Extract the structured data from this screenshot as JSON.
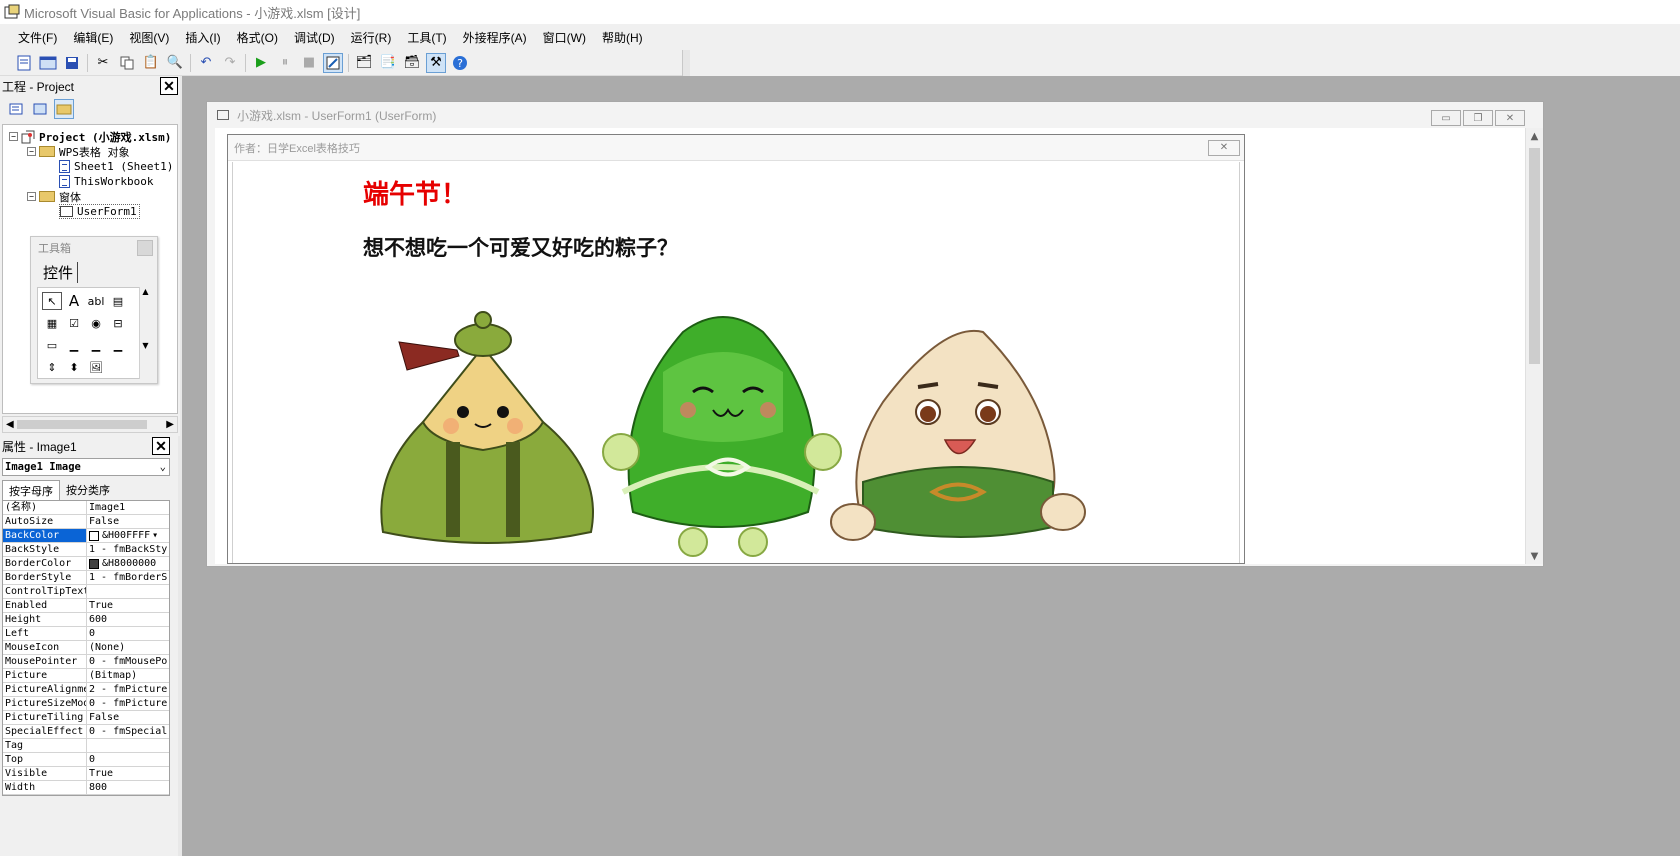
{
  "window": {
    "title": "Microsoft Visual Basic for Applications - 小游戏.xlsm [设计]"
  },
  "menu": [
    "文件(F)",
    "编辑(E)",
    "视图(V)",
    "插入(I)",
    "格式(O)",
    "调试(D)",
    "运行(R)",
    "工具(T)",
    "外接程序(A)",
    "窗口(W)",
    "帮助(H)"
  ],
  "project": {
    "title": "工程 - Project",
    "root": "Project (小游戏.xlsm)",
    "folder_objects": "WPS表格 对象",
    "sheet1": "Sheet1 (Sheet1)",
    "workbook": "ThisWorkbook",
    "folder_forms": "窗体",
    "form": "UserForm1"
  },
  "toolbox": {
    "title": "工具箱",
    "tab": "控件",
    "items": [
      "arrow-icon",
      "label-A",
      "abl",
      "combobox",
      "listbox",
      "checkbox",
      "option",
      "toggle",
      "frame",
      "command",
      "tabstrip",
      "multipage",
      "scrollbar",
      "spin",
      "image"
    ]
  },
  "properties": {
    "title": "属性 - Image1",
    "object": "Image1 Image",
    "tab_alpha": "按字母序",
    "tab_cat": "按分类序",
    "rows": [
      {
        "name": "(名称)",
        "value": "Image1"
      },
      {
        "name": "AutoSize",
        "value": "False"
      },
      {
        "name": "BackColor",
        "value": "&H00FFFF",
        "swatch": "#ffffff",
        "selected": true
      },
      {
        "name": "BackStyle",
        "value": "1 - fmBackSty"
      },
      {
        "name": "BorderColor",
        "value": "&H8000000",
        "swatch": "#404040"
      },
      {
        "name": "BorderStyle",
        "value": "1 - fmBorderS"
      },
      {
        "name": "ControlTipText",
        "value": ""
      },
      {
        "name": "Enabled",
        "value": "True"
      },
      {
        "name": "Height",
        "value": "600"
      },
      {
        "name": "Left",
        "value": "0"
      },
      {
        "name": "MouseIcon",
        "value": "(None)"
      },
      {
        "name": "MousePointer",
        "value": "0 - fmMousePo"
      },
      {
        "name": "Picture",
        "value": "(Bitmap)"
      },
      {
        "name": "PictureAlignme",
        "value": "2 - fmPicture"
      },
      {
        "name": "PictureSizeMod",
        "value": "0 - fmPicture"
      },
      {
        "name": "PictureTiling",
        "value": "False"
      },
      {
        "name": "SpecialEffect",
        "value": "0 - fmSpecial"
      },
      {
        "name": "Tag",
        "value": ""
      },
      {
        "name": "Top",
        "value": "0"
      },
      {
        "name": "Visible",
        "value": "True"
      },
      {
        "name": "Width",
        "value": "800"
      }
    ]
  },
  "form_window": {
    "title": "小游戏.xlsm - UserForm1 (UserForm)"
  },
  "userform": {
    "caption": "作者：日学Excel表格技巧",
    "heading": "端午节！",
    "question": "想不想吃一个可爱又好吃的粽子？"
  },
  "colors": {
    "heading_red": "#e60000",
    "selection_blue": "#0a64d6",
    "mdi_gray": "#ababab"
  }
}
